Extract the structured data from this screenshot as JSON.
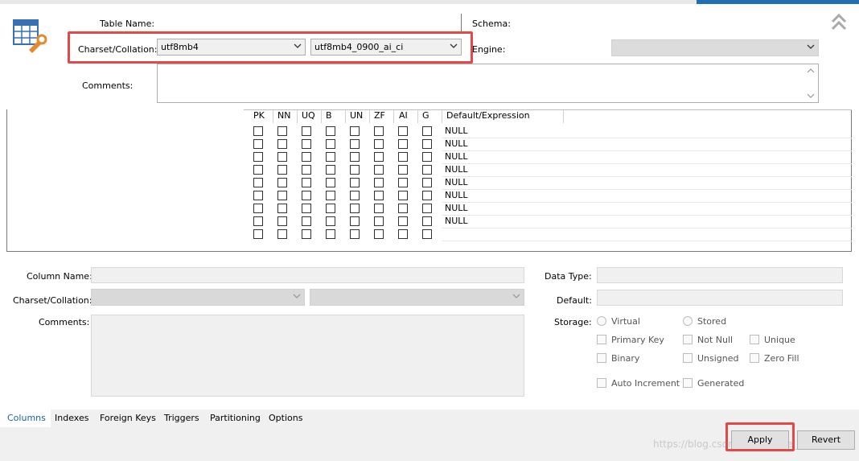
{
  "table": {
    "name_label": "Table Name:",
    "name_value": "",
    "schema_label": "Schema:",
    "schema_value": "",
    "charset_label": "Charset/Collation:",
    "charset_value": "utf8mb4",
    "collation_value": "utf8mb4_0900_ai_ci",
    "engine_label": "Engine:",
    "engine_value": "",
    "comments_label": "Comments:",
    "comments_value": ""
  },
  "grid": {
    "headers": [
      "PK",
      "NN",
      "UQ",
      "B",
      "UN",
      "ZF",
      "AI",
      "G",
      "Default/Expression"
    ],
    "rows": [
      {
        "default": "NULL"
      },
      {
        "default": "NULL"
      },
      {
        "default": "NULL"
      },
      {
        "default": "NULL"
      },
      {
        "default": "NULL"
      },
      {
        "default": "NULL"
      },
      {
        "default": "NULL"
      },
      {
        "default": "NULL"
      },
      {
        "default": ""
      }
    ]
  },
  "column_editor": {
    "column_name_label": "Column Name:",
    "column_name_value": "",
    "charset_label": "Charset/Collation:",
    "comments_label": "Comments:",
    "data_type_label": "Data Type:",
    "data_type_value": "",
    "default_label": "Default:",
    "default_value": "",
    "storage_label": "Storage:",
    "storage_options": [
      "Virtual",
      "Stored"
    ],
    "flags": {
      "primary_key": "Primary Key",
      "not_null": "Not Null",
      "unique": "Unique",
      "binary": "Binary",
      "unsigned": "Unsigned",
      "zero_fill": "Zero Fill",
      "auto_increment": "Auto Increment",
      "generated": "Generated"
    }
  },
  "tabs": [
    "Columns",
    "Indexes",
    "Foreign Keys",
    "Triggers",
    "Partitioning",
    "Options"
  ],
  "active_tab": "Columns",
  "buttons": {
    "apply": "Apply",
    "revert": "Revert"
  },
  "watermark": "https://blog.csdn.net/wallace_www",
  "colors": {
    "highlight_red": "#e24a4a",
    "active_tab": "#1a5fa8",
    "window_top_accent": "#1f6fb7"
  },
  "icons": [
    "table-editor-icon",
    "collapse-up-icon",
    "chevron-down-icon",
    "scroll-up-icon",
    "scroll-down-icon"
  ]
}
